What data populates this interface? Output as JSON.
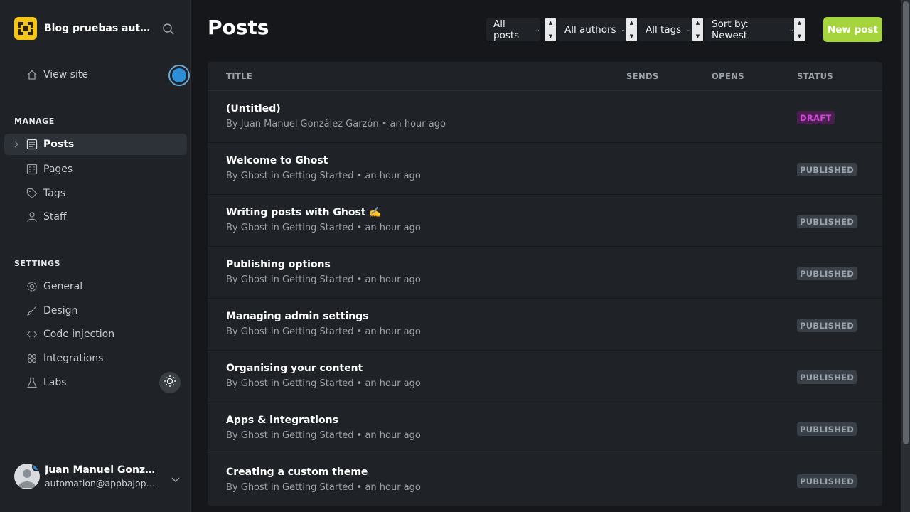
{
  "sidebar": {
    "brand_title": "Blog pruebas auto...",
    "view_site": "View site",
    "manage_label": "MANAGE",
    "settings_label": "SETTINGS",
    "manage_items": [
      {
        "label": "Posts",
        "icon": "posts-icon",
        "active": true
      },
      {
        "label": "Pages",
        "icon": "pages-icon"
      },
      {
        "label": "Tags",
        "icon": "tag-icon"
      },
      {
        "label": "Staff",
        "icon": "staff-icon"
      }
    ],
    "settings_items": [
      {
        "label": "General",
        "icon": "gear-icon"
      },
      {
        "label": "Design",
        "icon": "brush-icon"
      },
      {
        "label": "Code injection",
        "icon": "code-icon"
      },
      {
        "label": "Integrations",
        "icon": "integrations-icon"
      },
      {
        "label": "Labs",
        "icon": "flask-icon"
      }
    ],
    "user": {
      "name": "Juan Manuel Gonzále...",
      "email": "automation@appbajopru..."
    }
  },
  "main": {
    "title": "Posts",
    "filters": {
      "type": "All posts",
      "authors": "All authors",
      "tags": "All tags",
      "sort": "Sort by: Newest"
    },
    "new_post_label": "New post",
    "columns": {
      "title": "TITLE",
      "sends": "SENDS",
      "opens": "OPENS",
      "status": "STATUS"
    },
    "posts": [
      {
        "title": "(Untitled)",
        "meta": "By Juan Manuel González Garzón • an hour ago",
        "status": "DRAFT"
      },
      {
        "title": "Welcome to Ghost",
        "meta": "By Ghost in Getting Started • an hour ago",
        "status": "PUBLISHED"
      },
      {
        "title": "Writing posts with Ghost ✍️",
        "meta": "By Ghost in Getting Started • an hour ago",
        "status": "PUBLISHED"
      },
      {
        "title": "Publishing options",
        "meta": "By Ghost in Getting Started • an hour ago",
        "status": "PUBLISHED"
      },
      {
        "title": "Managing admin settings",
        "meta": "By Ghost in Getting Started • an hour ago",
        "status": "PUBLISHED"
      },
      {
        "title": "Organising your content",
        "meta": "By Ghost in Getting Started • an hour ago",
        "status": "PUBLISHED"
      },
      {
        "title": "Apps & integrations",
        "meta": "By Ghost in Getting Started • an hour ago",
        "status": "PUBLISHED"
      },
      {
        "title": "Creating a custom theme",
        "meta": "By Ghost in Getting Started • an hour ago",
        "status": "PUBLISHED"
      }
    ]
  },
  "colors": {
    "accent": "#a5d43c",
    "draft": "#d147d8",
    "notification": "#2d8fd8"
  }
}
